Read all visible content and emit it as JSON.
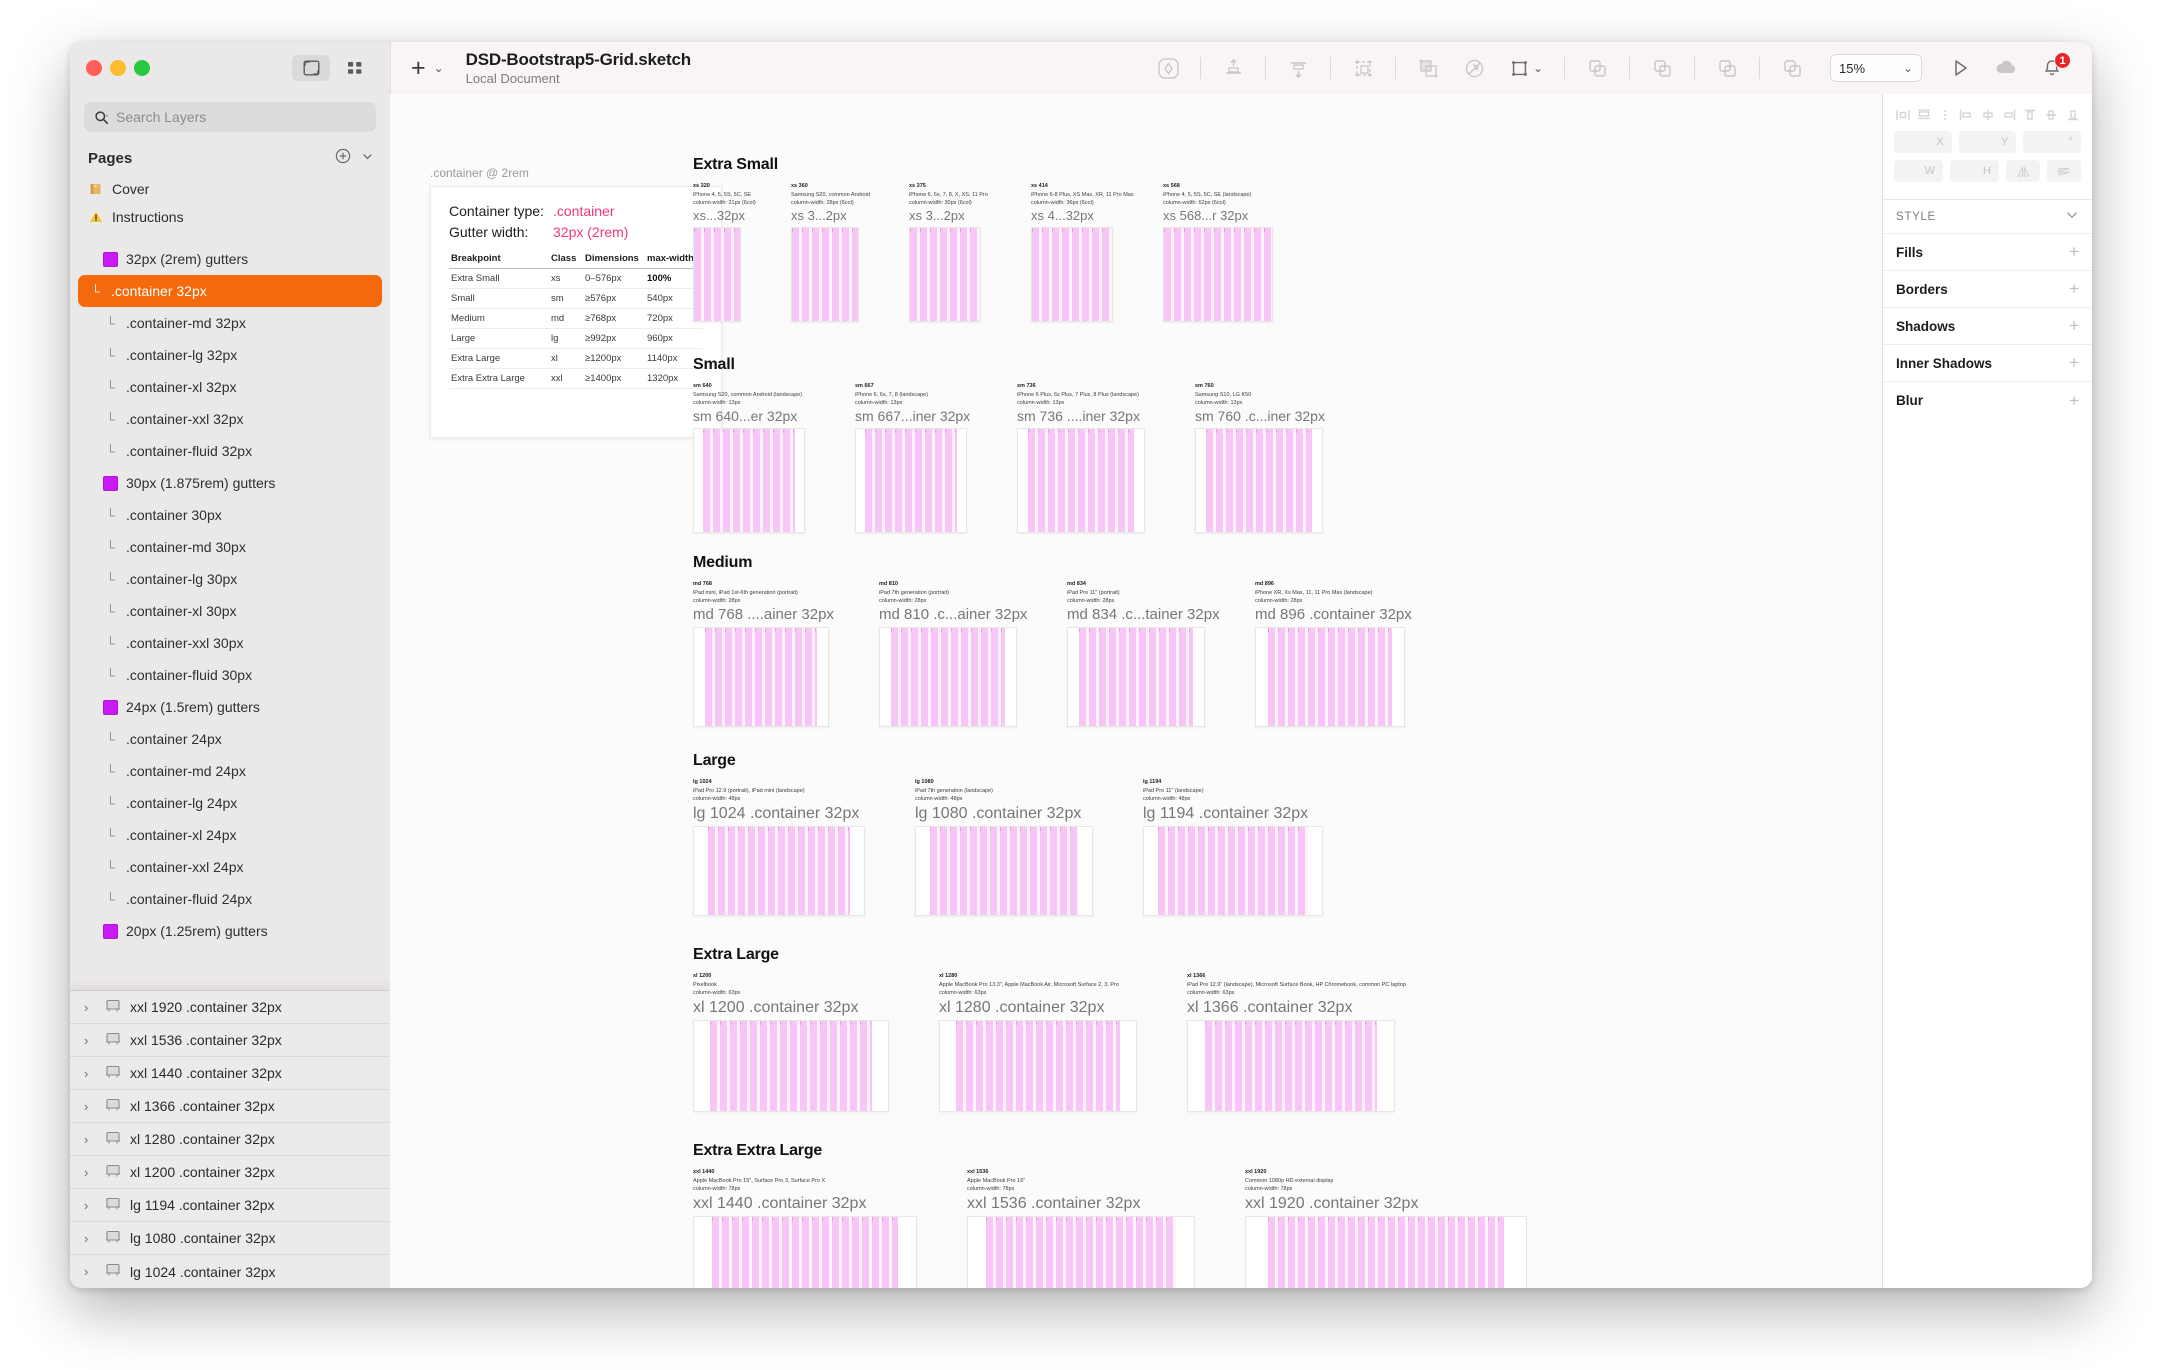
{
  "window": {
    "traffic_lights": [
      "close",
      "minimize",
      "zoom"
    ],
    "view_toggle_canvas": "canvas-view",
    "view_toggle_grid": "grid-view"
  },
  "toolbar": {
    "add_label": "+",
    "add_caret": "⌄",
    "document_title": "DSD-Bootstrap5-Grid.sketch",
    "document_subtitle": "Local Document",
    "zoom_value": "15%",
    "zoom_caret": "⌄",
    "notification_count": "1",
    "tools": [
      {
        "name": "component-icon"
      },
      {
        "name": "align-top-icon"
      },
      {
        "name": "align-bottom-icon"
      },
      {
        "name": "group-selection-icon"
      },
      {
        "name": "mask-icon"
      },
      {
        "name": "rotate-copies-icon"
      },
      {
        "name": "scale-icon"
      },
      {
        "name": "union-icon"
      },
      {
        "name": "subtract-icon"
      },
      {
        "name": "intersect-icon"
      },
      {
        "name": "difference-icon"
      }
    ]
  },
  "sidebar": {
    "search": {
      "placeholder": "Search Layers",
      "value": ""
    },
    "pages_title": "Pages",
    "pages": [
      {
        "label": "Cover",
        "icon": "book-icon"
      },
      {
        "label": "Instructions",
        "icon": "warning-icon"
      }
    ],
    "layers": [
      {
        "label": "32px (2rem) gutters",
        "type": "group",
        "selected": false
      },
      {
        "label": ".container 32px",
        "type": "child",
        "selected": true
      },
      {
        "label": ".container-md 32px",
        "type": "child",
        "selected": false
      },
      {
        "label": ".container-lg 32px",
        "type": "child",
        "selected": false
      },
      {
        "label": ".container-xl 32px",
        "type": "child",
        "selected": false
      },
      {
        "label": ".container-xxl 32px",
        "type": "child",
        "selected": false
      },
      {
        "label": ".container-fluid 32px",
        "type": "child",
        "selected": false
      },
      {
        "label": "30px (1.875rem) gutters",
        "type": "group",
        "selected": false
      },
      {
        "label": ".container 30px",
        "type": "child",
        "selected": false
      },
      {
        "label": ".container-md 30px",
        "type": "child",
        "selected": false
      },
      {
        "label": ".container-lg 30px",
        "type": "child",
        "selected": false
      },
      {
        "label": ".container-xl 30px",
        "type": "child",
        "selected": false
      },
      {
        "label": ".container-xxl 30px",
        "type": "child",
        "selected": false
      },
      {
        "label": ".container-fluid 30px",
        "type": "child",
        "selected": false
      },
      {
        "label": "24px (1.5rem) gutters",
        "type": "group",
        "selected": false
      },
      {
        "label": ".container 24px",
        "type": "child",
        "selected": false
      },
      {
        "label": ".container-md 24px",
        "type": "child",
        "selected": false
      },
      {
        "label": ".container-lg 24px",
        "type": "child",
        "selected": false
      },
      {
        "label": ".container-xl 24px",
        "type": "child",
        "selected": false
      },
      {
        "label": ".container-xxl 24px",
        "type": "child",
        "selected": false
      },
      {
        "label": ".container-fluid 24px",
        "type": "child",
        "selected": false
      },
      {
        "label": "20px (1.25rem) gutters",
        "type": "group",
        "selected": false
      }
    ],
    "artboards": [
      {
        "label": "xxl 1920 .container 32px"
      },
      {
        "label": "xxl 1536 .container 32px"
      },
      {
        "label": "xxl 1440 .container 32px"
      },
      {
        "label": "xl 1366 .container 32px"
      },
      {
        "label": "xl 1280 .container 32px"
      },
      {
        "label": "xl 1200 .container 32px"
      },
      {
        "label": "lg 1194 .container 32px"
      },
      {
        "label": "lg 1080 .container 32px"
      },
      {
        "label": "lg 1024 .container 32px"
      }
    ]
  },
  "canvas": {
    "info_artboard_label": ".container @ 2rem",
    "info_card": {
      "container_type_key": "Container type:",
      "container_type_value": ".container",
      "gutter_key": "Gutter width:",
      "gutter_value": "32px (2rem)",
      "table": {
        "headers": [
          "Breakpoint",
          "Class",
          "Dimensions",
          "max-width"
        ],
        "rows": [
          [
            "Extra Small",
            "xs",
            "0–576px",
            "100%"
          ],
          [
            "Small",
            "sm",
            "≥576px",
            "540px"
          ],
          [
            "Medium",
            "md",
            "≥768px",
            "720px"
          ],
          [
            "Large",
            "lg",
            "≥992px",
            "960px"
          ],
          [
            "Extra Large",
            "xl",
            "≥1200px",
            "1140px"
          ],
          [
            "Extra Extra Large",
            "xxl",
            "≥1400px",
            "1320px"
          ]
        ]
      }
    },
    "sections": [
      {
        "heading": "Extra Small",
        "artboards": [
          {
            "name": "xs 320",
            "devices": "iPhone 4, 5, 5S, 5C, SE",
            "column": "column-width: 21px (6col)",
            "title": "xs...32px"
          },
          {
            "name": "xs 360",
            "devices": "Samsung S20, common Android",
            "column": "column-width: 28px (6col)",
            "title": "xs 3...2px"
          },
          {
            "name": "xs 375",
            "devices": "iPhone 6, 6s, 7, 8, X, XS, 11 Pro",
            "column": "column-width: 30px (6col)",
            "title": "xs 3...2px"
          },
          {
            "name": "xs 414",
            "devices": "iPhone 6-8 Plus, XS Max, XR, 11 Pro Max",
            "column": "column-width: 36px (6col)",
            "title": "xs 4...32px"
          },
          {
            "name": "xs 568",
            "devices": "iPhone 4, 5, 5S, 5C, SE (landscape)",
            "column": "column-width: 62px (6col)",
            "title": "xs 568...r 32px"
          }
        ]
      },
      {
        "heading": "Small",
        "artboards": [
          {
            "name": "sm 640",
            "devices": "Samsung S20, common Android (landscape)",
            "column": "column-width: 13px",
            "title": "sm 640...er 32px"
          },
          {
            "name": "sm 667",
            "devices": "iPhone 6, 6s, 7, 8 (landscape)",
            "column": "column-width: 13px",
            "title": "sm 667...iner 32px"
          },
          {
            "name": "sm 736",
            "devices": "iPhone 6 Plus, 6s Plus, 7 Plus, 8 Plus (landscape)",
            "column": "column-width: 13px",
            "title": "sm 736 ....iner 32px"
          },
          {
            "name": "sm 760",
            "devices": "Samsung S10, LG K50",
            "column": "column-width: 13px",
            "title": "sm 760 .c...iner 32px"
          }
        ]
      },
      {
        "heading": "Medium",
        "artboards": [
          {
            "name": "md 768",
            "devices": "iPad mini, iPad 1st-6th generation (portrait)",
            "column": "column-width: 28px",
            "title": "md 768 ....ainer 32px"
          },
          {
            "name": "md 810",
            "devices": "iPad 7th generation (portrait)",
            "column": "column-width: 28px",
            "title": "md 810 .c...ainer 32px"
          },
          {
            "name": "md 834",
            "devices": "iPad Pro 11\" (portrait)",
            "column": "column-width: 28px",
            "title": "md 834 .c...tainer 32px"
          },
          {
            "name": "md 896",
            "devices": "iPhone XR, Xs Max, 11, 11 Pro Max (landscape)",
            "column": "column-width: 28px",
            "title": "md 896 .container 32px"
          }
        ]
      },
      {
        "heading": "Large",
        "artboards": [
          {
            "name": "lg 1024",
            "devices": "iPad Pro 12.9 (portrait), iPad mini (landscape)",
            "column": "column-width: 48px",
            "title": "lg 1024 .container 32px"
          },
          {
            "name": "lg 1080",
            "devices": "iPad 7th generation (landscape)",
            "column": "column-width: 48px",
            "title": "lg 1080 .container 32px"
          },
          {
            "name": "lg 1194",
            "devices": "iPad Pro 11\" (landscape)",
            "column": "column-width: 48px",
            "title": "lg 1194 .container 32px"
          }
        ]
      },
      {
        "heading": "Extra Large",
        "artboards": [
          {
            "name": "xl 1200",
            "devices": "Pixelbook",
            "column": "column-width: 63px",
            "title": "xl 1200 .container 32px"
          },
          {
            "name": "xl 1280",
            "devices": "Apple MacBook Pro 13.3\", Apple MacBook Air, Microsoft Surface 2, 3, Pro",
            "column": "column-width: 63px",
            "title": "xl 1280 .container 32px"
          },
          {
            "name": "xl 1366",
            "devices": "iPad Pro 12.9\" (landscape), Microsoft Surface Book, HP Chromebook, common PC laptop",
            "column": "column-width: 63px",
            "title": "xl 1366 .container 32px"
          }
        ]
      },
      {
        "heading": "Extra Extra Large",
        "artboards": [
          {
            "name": "xxl 1440",
            "devices": "Apple MacBook Pro 15\", Surface Pro 3, Surface Pro X",
            "column": "column-width: 78px",
            "title": "xxl 1440 .container 32px"
          },
          {
            "name": "xxl 1536",
            "devices": "Apple MacBook Pro 16\"",
            "column": "column-width: 78px",
            "title": "xxl 1536 .container 32px"
          },
          {
            "name": "xxl 1920",
            "devices": "Common 1080p HD external display",
            "column": "column-width: 78px",
            "title": "xxl 1920 .container 32px"
          }
        ]
      }
    ]
  },
  "inspector": {
    "fields": {
      "x_label": "X",
      "y_label": "Y",
      "rotation_label": "°",
      "w_label": "W",
      "h_label": "H"
    },
    "style_header": "STYLE",
    "style_rows": [
      {
        "label": "Fills"
      },
      {
        "label": "Borders"
      },
      {
        "label": "Shadows"
      },
      {
        "label": "Inner Shadows"
      },
      {
        "label": "Blur"
      }
    ]
  },
  "colors": {
    "accent_selected": "#f3690b",
    "swatch_purple": "#c81bf5",
    "link_pink": "#f0367b",
    "badge_red": "#e8262a",
    "grid_pink": "#f7c4f7"
  }
}
